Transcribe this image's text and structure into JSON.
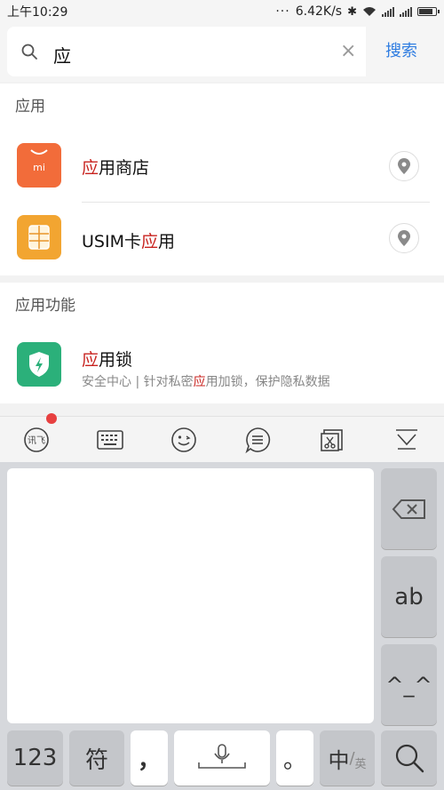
{
  "status_bar": {
    "time": "上午10:29",
    "speed": "6.42K/s"
  },
  "search": {
    "query": "应",
    "button_label": "搜索"
  },
  "sections": {
    "apps_header": "应用",
    "features_header": "应用功能"
  },
  "apps": [
    {
      "title_hl": "应",
      "title_rest": "用商店",
      "icon_text": "mi"
    },
    {
      "title_pre": "USIM卡",
      "title_hl": "应",
      "title_rest": "用"
    }
  ],
  "feature": {
    "title_hl": "应",
    "title_rest": "用锁",
    "subtitle_pre": "安全中心 | 针对私密",
    "subtitle_hl": "应",
    "subtitle_rest": "用加锁，保护隐私数据"
  },
  "toolbar": {
    "items": [
      "xunfei-icon",
      "keyboard-icon",
      "emoji-icon",
      "chat-icon",
      "clipboard-icon",
      "collapse-icon"
    ]
  },
  "keyboard": {
    "k_123": "123",
    "k_symbol": "符",
    "k_comma": "，",
    "k_period": "。",
    "k_lang_main": "中",
    "k_lang_sep": "/",
    "k_lang_alt": "英",
    "k_ab": "ab",
    "k_face": "^_^"
  },
  "colors": {
    "accent": "#2f7de1",
    "highlight": "#c8231f",
    "mi_orange": "#f26c3a",
    "sim_orange": "#f2a531",
    "shield_green": "#2bb07a"
  }
}
